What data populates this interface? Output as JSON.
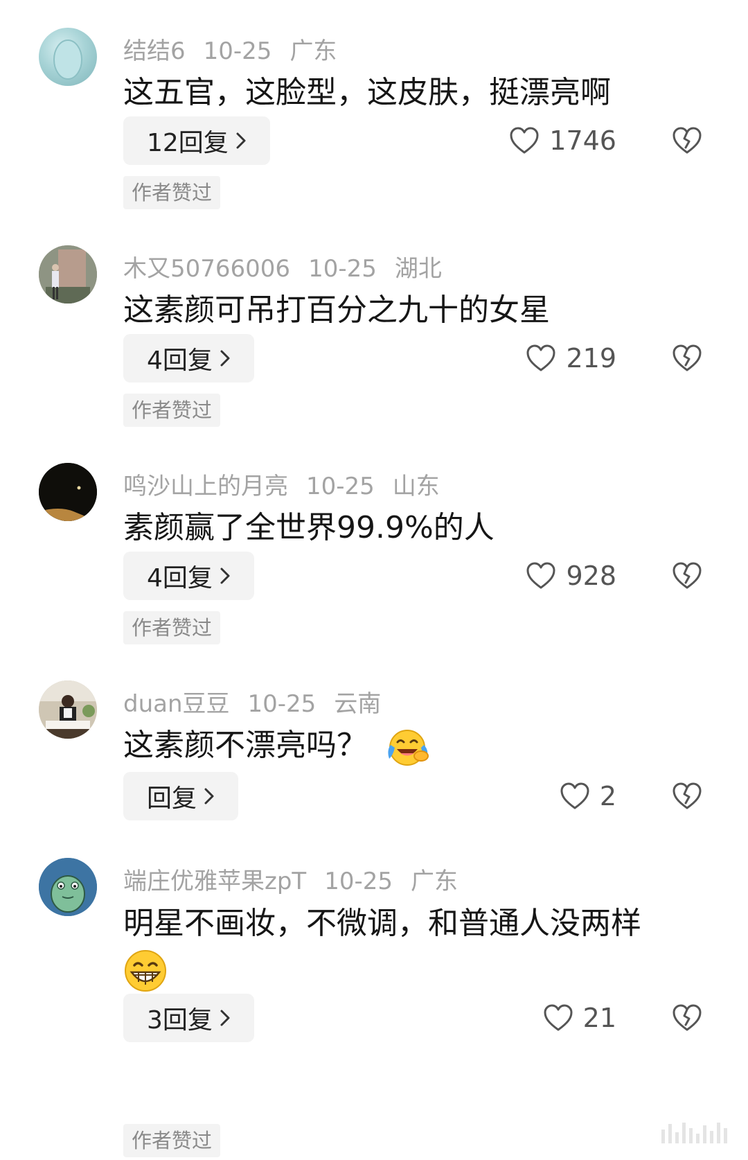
{
  "comments": [
    {
      "username": "结结6",
      "date": "10-25",
      "location": "广东",
      "text": "这五官，这脸型，这皮肤，挺漂亮啊",
      "reply_label": "12回复",
      "likes": "1746",
      "author_liked_label": "作者赞过"
    },
    {
      "username": "木又50766006",
      "date": "10-25",
      "location": "湖北",
      "text": "这素颜可吊打百分之九十的女星",
      "reply_label": "4回复",
      "likes": "219",
      "author_liked_label": "作者赞过"
    },
    {
      "username": "鸣沙山上的月亮",
      "date": "10-25",
      "location": "山东",
      "text": "素颜赢了全世界99.9%的人",
      "reply_label": "4回复",
      "likes": "928",
      "author_liked_label": "作者赞过"
    },
    {
      "username": "duan豆豆",
      "date": "10-25",
      "location": "云南",
      "text": "这素颜不漂亮吗？",
      "emoji": "laughing-crying-emoji",
      "reply_label": "回复",
      "likes": "2"
    },
    {
      "username": "端庄优雅苹果zpT",
      "date": "10-25",
      "location": "广东",
      "text": "明星不画妆，不微调，和普通人没两样",
      "emoji": "grinning-emoji",
      "reply_label": "3回复",
      "likes": "21",
      "author_liked_label": "作者赞过"
    }
  ],
  "icons": {
    "like": "heart-outline-icon",
    "dislike": "broken-heart-icon",
    "chevron": "chevron-right-icon"
  },
  "colors": {
    "meta_text": "#a3a3a3",
    "body_text": "#161616",
    "chip_bg": "#f3f3f3"
  }
}
